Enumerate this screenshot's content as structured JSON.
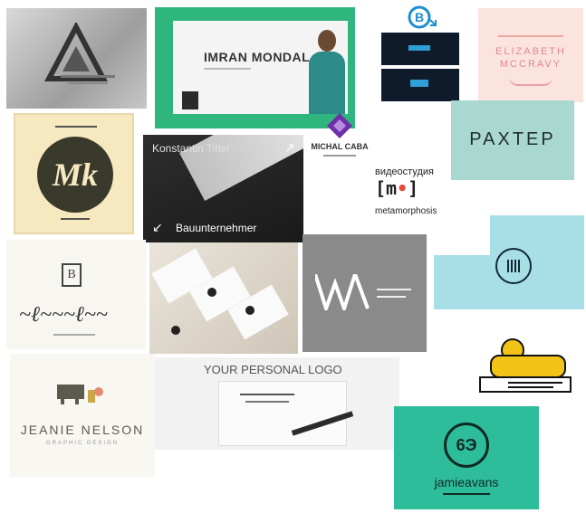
{
  "tiles": {
    "imran": {
      "name": "IMRAN MONDAL"
    },
    "elizabeth": {
      "line1": "ELIZABETH",
      "line2": "MCCRAVY"
    },
    "michal": {
      "name": "MICHAL CABA"
    },
    "raxter": {
      "word": "PAXTEP"
    },
    "konstantin": {
      "top": "Konstantin Tittel",
      "bottom": "Bauunternehmer"
    },
    "videostudio": {
      "line1": "видеостудия",
      "mark": "[m•]",
      "line3": "metamorphosis"
    },
    "jeanie": {
      "name": "JEANIE NELSON",
      "sub": "GRAPHIC DESIGN"
    },
    "personal": {
      "title": "YOUR PERSONAL LOGO"
    },
    "jamie": {
      "name": "jamieavans"
    }
  },
  "colors": {
    "green_frame": "#2fb67c",
    "teal_block": "#2ebd9a",
    "mint": "#a9d8d0",
    "light_blue": "#a8dfe6",
    "pink": "#fbe3de",
    "cream": "#f6e9c0",
    "dark_olive": "#3a3a2c",
    "gray_tile": "#8a8a8a",
    "purple": "#6f2fa8",
    "navy": "#0f1a2a",
    "yellow": "#f2c418",
    "red_dot": "#e54b36"
  }
}
